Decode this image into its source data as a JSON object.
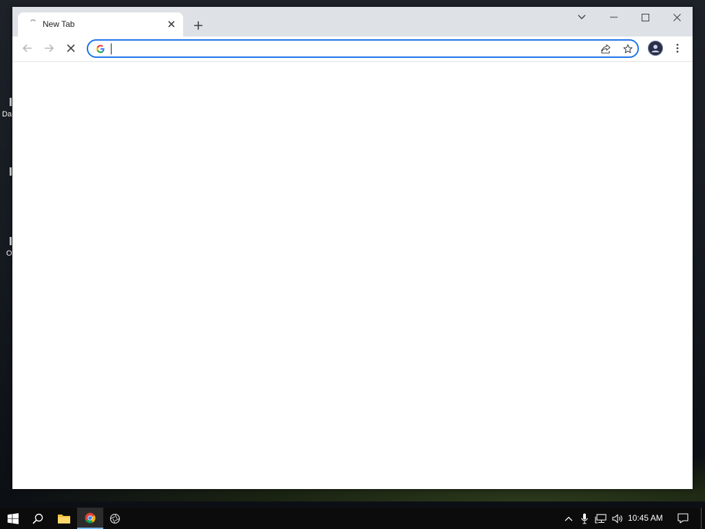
{
  "desktop": {
    "fragments": [
      "Da",
      "O"
    ]
  },
  "browser": {
    "tab": {
      "title": "New Tab"
    },
    "address_bar": {
      "value": "",
      "placeholder": ""
    },
    "accent_color": "#1a73e8",
    "tabstrip_color": "#dee1e6"
  },
  "taskbar": {
    "clock": "10:45 AM",
    "pinned": [
      "windows-start",
      "search",
      "file-explorer",
      "chrome",
      "other-app"
    ]
  }
}
